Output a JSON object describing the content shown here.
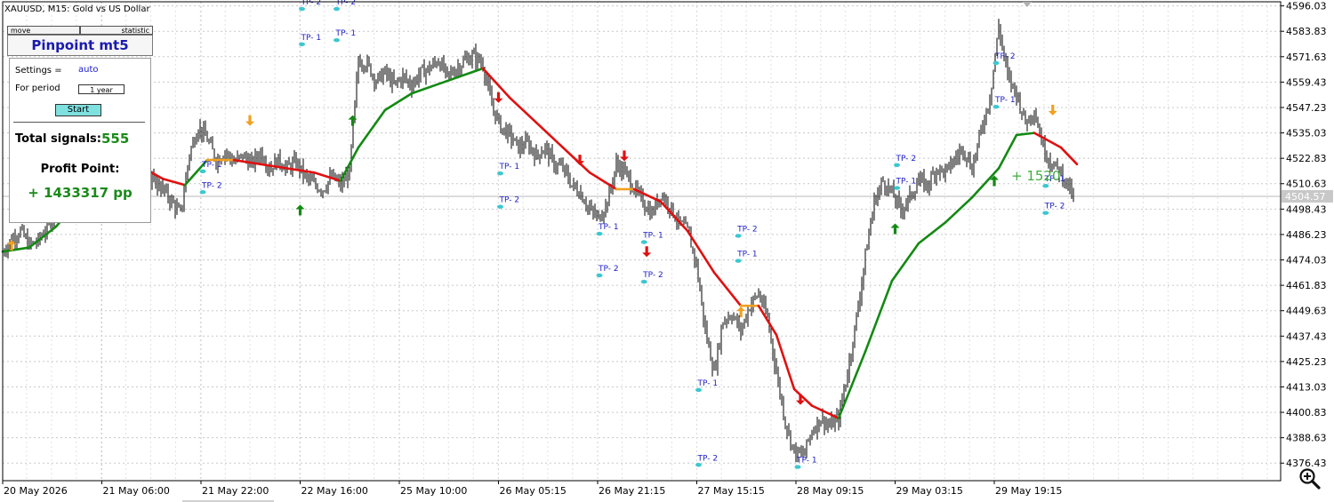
{
  "window": {
    "symbol_title": "XAUUSD, M15:  Gold vs US Dollar"
  },
  "panel": {
    "move_label": "move",
    "statistic_label": "statistic",
    "title": "Pinpoint mt5",
    "settings_label": "Settings  =",
    "settings_value": "auto",
    "period_label": "For period",
    "period_value": "1 year",
    "start_label": "Start",
    "total_label": "Total signals:",
    "total_value": "555",
    "profit_label": "Profit Point:",
    "profit_value": "+ 1433317 pp"
  },
  "overlay_profit_text": "+ 1520",
  "current_price_label": "4504.57",
  "colors": {
    "bull_line": "#138a13",
    "bear_line": "#e01010",
    "neutral_line": "#f0a020",
    "candle": "#000000",
    "tp_marker": "#3cc8d0",
    "tp_text": "#2020c8",
    "up_arrow": "#138a13",
    "down_arrow": "#e01010",
    "alt_arrow": "#f0a020"
  },
  "chart_data": {
    "type": "line",
    "title": "XAUUSD, M15:  Gold vs US Dollar",
    "xlabel": "",
    "ylabel": "",
    "ylim": [
      4368.0,
      4598.0
    ],
    "grid": true,
    "y_ticks": [
      "4596.03",
      "4583.83",
      "4571.63",
      "4559.43",
      "4547.23",
      "4535.03",
      "4522.83",
      "4510.63",
      "4498.43",
      "4486.23",
      "4474.03",
      "4461.83",
      "4449.63",
      "4437.43",
      "4425.23",
      "4413.03",
      "4400.83",
      "4388.63",
      "4376.43"
    ],
    "x_ticks": [
      "20 May 2026",
      "21 May 06:00",
      "21 May 22:00",
      "22 May 16:00",
      "25 May 10:00",
      "26 May 05:15",
      "26 May 21:15",
      "27 May 15:15",
      "28 May 09:15",
      "29 May 03:15",
      "29 May 19:15"
    ],
    "price_x": [
      0,
      10,
      20,
      30,
      40,
      50,
      60,
      70,
      80,
      90,
      100,
      110,
      120,
      130,
      140,
      150,
      160,
      170,
      180,
      190,
      200,
      210,
      220,
      230,
      240,
      250,
      260,
      270,
      280,
      290,
      300,
      310,
      320,
      330,
      340,
      350,
      360,
      370,
      380,
      390,
      400,
      410,
      420,
      430,
      440,
      450,
      460,
      470,
      480,
      490,
      500,
      510,
      520,
      530,
      540,
      550,
      560,
      570,
      580,
      590,
      600,
      610,
      620,
      630,
      640,
      650,
      660,
      670,
      680,
      690,
      700,
      710,
      720,
      730,
      740,
      750,
      760,
      770,
      780,
      790,
      800,
      810,
      820,
      830,
      840,
      850,
      860,
      870,
      880,
      890,
      900,
      910,
      920,
      930,
      940,
      950,
      960,
      970,
      980,
      990,
      1000,
      1010,
      1020,
      1030,
      1040,
      1050,
      1060,
      1070,
      1080,
      1090,
      1100,
      1110,
      1120,
      1130,
      1140,
      1150,
      1160,
      1170,
      1180,
      1190,
      1200,
      1205
    ],
    "price_y": [
      4478,
      4484,
      4488,
      4481,
      4483,
      4490,
      4498,
      4512,
      4520,
      4526,
      4522,
      4518,
      4512,
      4508,
      4518,
      4512,
      4505,
      4512,
      4508,
      4502,
      4496,
      4525,
      4538,
      4532,
      4522,
      4526,
      4521,
      4524,
      4520,
      4526,
      4518,
      4522,
      4518,
      4521,
      4514,
      4510,
      4508,
      4514,
      4510,
      4516,
      4570,
      4568,
      4560,
      4564,
      4558,
      4562,
      4558,
      4564,
      4566,
      4570,
      4562,
      4566,
      4570,
      4572,
      4568,
      4548,
      4538,
      4534,
      4528,
      4530,
      4524,
      4528,
      4520,
      4518,
      4510,
      4506,
      4498,
      4494,
      4502,
      4520,
      4516,
      4508,
      4502,
      4496,
      4506,
      4500,
      4492,
      4488,
      4472,
      4440,
      4420,
      4445,
      4448,
      4440,
      4452,
      4458,
      4446,
      4420,
      4396,
      4382,
      4380,
      4392,
      4398,
      4394,
      4398,
      4420,
      4446,
      4476,
      4502,
      4512,
      4506,
      4498,
      4504,
      4512,
      4510,
      4518,
      4516,
      4522,
      4528,
      4518,
      4536,
      4552,
      4586,
      4562,
      4554,
      4540,
      4546,
      4528,
      4520,
      4516,
      4508,
      4502
    ],
    "series": [
      {
        "name": "",
        "x": [
          0,
          30,
          60,
          90,
          120,
          150,
          180,
          205,
          230,
          260,
          290,
          320,
          350,
          380,
          400,
          430,
          460,
          500,
          540,
          570,
          600,
          630,
          660,
          690,
          710,
          740,
          770,
          800,
          830,
          850,
          870,
          890,
          910,
          940,
          970,
          1000,
          1030,
          1060,
          1090,
          1120,
          1140,
          1160,
          1190,
          1208
        ],
        "y": [
          4478,
          4480,
          4490,
          4505,
          4518,
          4520,
          4513,
          4510,
          4522,
          4522,
          4520,
          4518,
          4516,
          4512,
          4528,
          4546,
          4554,
          4560,
          4566,
          4552,
          4540,
          4528,
          4516,
          4508,
          4508,
          4502,
          4488,
          4468,
          4452,
          4452,
          4438,
          4412,
          4404,
          4398,
          4430,
          4464,
          4482,
          4492,
          4504,
          4518,
          4534,
          4535,
          4528,
          4520
        ]
      }
    ]
  },
  "tp_labels": [
    {
      "text": "TP- 2",
      "price": 4595,
      "time": "22 May 16:00"
    },
    {
      "text": "TP- 2",
      "price": 4595,
      "time": "25 May"
    },
    {
      "text": "TP- 1",
      "price": 4578,
      "time": "22 May 16:00"
    },
    {
      "text": "TP- 1",
      "price": 4580,
      "time": "25 May"
    },
    {
      "text": "TP- 1",
      "price": 4517,
      "time": "21 May 22:00"
    },
    {
      "text": "TP- 2",
      "price": 4507,
      "time": "21 May 22:00"
    },
    {
      "text": "TP- 1",
      "price": 4516,
      "time": "26 May 05:15"
    },
    {
      "text": "TP- 2",
      "price": 4500,
      "time": "26 May 05:15"
    },
    {
      "text": "TP- 1",
      "price": 4487,
      "time": "26 May 21:15"
    },
    {
      "text": "TP- 2",
      "price": 4467,
      "time": "26 May 21:15"
    },
    {
      "text": "TP- 1",
      "price": 4483,
      "time": "27 May"
    },
    {
      "text": "TP- 2",
      "price": 4464,
      "time": "27 May"
    },
    {
      "text": "TP- 1",
      "price": 4412,
      "time": "27 May 15:15"
    },
    {
      "text": "TP- 2",
      "price": 4376,
      "time": "27 May 15:15"
    },
    {
      "text": "TP- 2",
      "price": 4486,
      "time": "27 May 18:00"
    },
    {
      "text": "TP- 1",
      "price": 4474,
      "time": "27 May 18:00"
    },
    {
      "text": "TP- 1",
      "price": 4375,
      "time": "28 May 09:15"
    },
    {
      "text": "TP- 2",
      "price": 4520,
      "time": "29 May 03:15"
    },
    {
      "text": "TP- 1",
      "price": 4509,
      "time": "29 May 03:15"
    },
    {
      "text": "TP- 2",
      "price": 4569,
      "time": "29 May 19:15"
    },
    {
      "text": "TP- 1",
      "price": 4548,
      "time": "29 May 19:15"
    },
    {
      "text": "TP- 1",
      "price": 4510,
      "time": "29 May 22:00"
    },
    {
      "text": "TP- 2",
      "price": 4497,
      "time": "29 May 22:00"
    }
  ],
  "signal_arrows": [
    {
      "dir": "up",
      "color": "alt",
      "time": "20 May 2026"
    },
    {
      "dir": "down",
      "color": "alt",
      "time": "21 May 22:00"
    },
    {
      "dir": "up",
      "color": "bull",
      "time": "22 May 16:00"
    },
    {
      "dir": "up",
      "color": "bull",
      "time": "25 May"
    },
    {
      "dir": "down",
      "color": "bear",
      "time": "26 May 05:15"
    },
    {
      "dir": "down",
      "color": "bear",
      "time": "26 May 21:15"
    },
    {
      "dir": "down",
      "color": "bear",
      "time": "26 May 21:15"
    },
    {
      "dir": "down",
      "color": "bear",
      "time": "27 May"
    },
    {
      "dir": "up",
      "color": "alt",
      "time": "27 May 18:00"
    },
    {
      "dir": "down",
      "color": "bear",
      "time": "28 May 09:15"
    },
    {
      "dir": "up",
      "color": "bull",
      "time": "29 May 03:15"
    },
    {
      "dir": "up",
      "color": "bull",
      "time": "29 May 19:15"
    },
    {
      "dir": "down",
      "color": "alt",
      "time": "29 May 22:00"
    }
  ]
}
